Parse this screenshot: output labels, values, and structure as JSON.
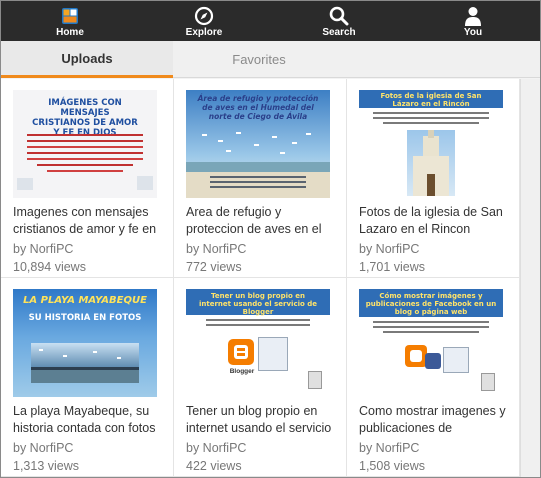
{
  "nav": {
    "home": "Home",
    "explore": "Explore",
    "search": "Search",
    "you": "You"
  },
  "tabs": {
    "uploads": "Uploads",
    "favorites": "Favorites"
  },
  "colors": {
    "nav_bg": "#2b2b2b",
    "tab_accent": "#f08a1c",
    "text": "#333333",
    "meta_text": "#777777"
  },
  "items": [
    {
      "title": "Imagenes con mensajes cristianos de amor y fe en",
      "author": "by NorfiPC",
      "views": "10,894 views",
      "thumb_heading": "IMÁGENES CON MENSAJES CRISTIANOS DE AMOR Y FE EN DIOS"
    },
    {
      "title": "Area de refugio y proteccion de aves en el",
      "author": "by NorfiPC",
      "views": "772 views",
      "thumb_heading": "Área de refugio y protección de aves en el Humedal del norte de Ciego de Ávila"
    },
    {
      "title": "Fotos de la iglesia de San Lazaro en el Rincon",
      "author": "by NorfiPC",
      "views": "1,701 views",
      "thumb_heading": "Fotos de la iglesia de San Lázaro en el Rincón"
    },
    {
      "title": "La playa Mayabeque, su historia contada con fotos",
      "author": "by NorfiPC",
      "views": "1,313 views",
      "thumb_heading": "LA PLAYA MAYABEQUE",
      "thumb_subheading": "SU HISTORIA EN FOTOS"
    },
    {
      "title": "Tener un blog propio en internet usando el servicio",
      "author": "by NorfiPC",
      "views": "422 views",
      "thumb_heading": "Tener un blog propio en internet usando el servicio de Blogger",
      "thumb_logo": "Blogger"
    },
    {
      "title": "Como mostrar imagenes y publicaciones de",
      "author": "by NorfiPC",
      "views": "1,508 views",
      "thumb_heading": "Cómo mostrar imágenes y publicaciones de Facebook en un blog o página web"
    }
  ]
}
